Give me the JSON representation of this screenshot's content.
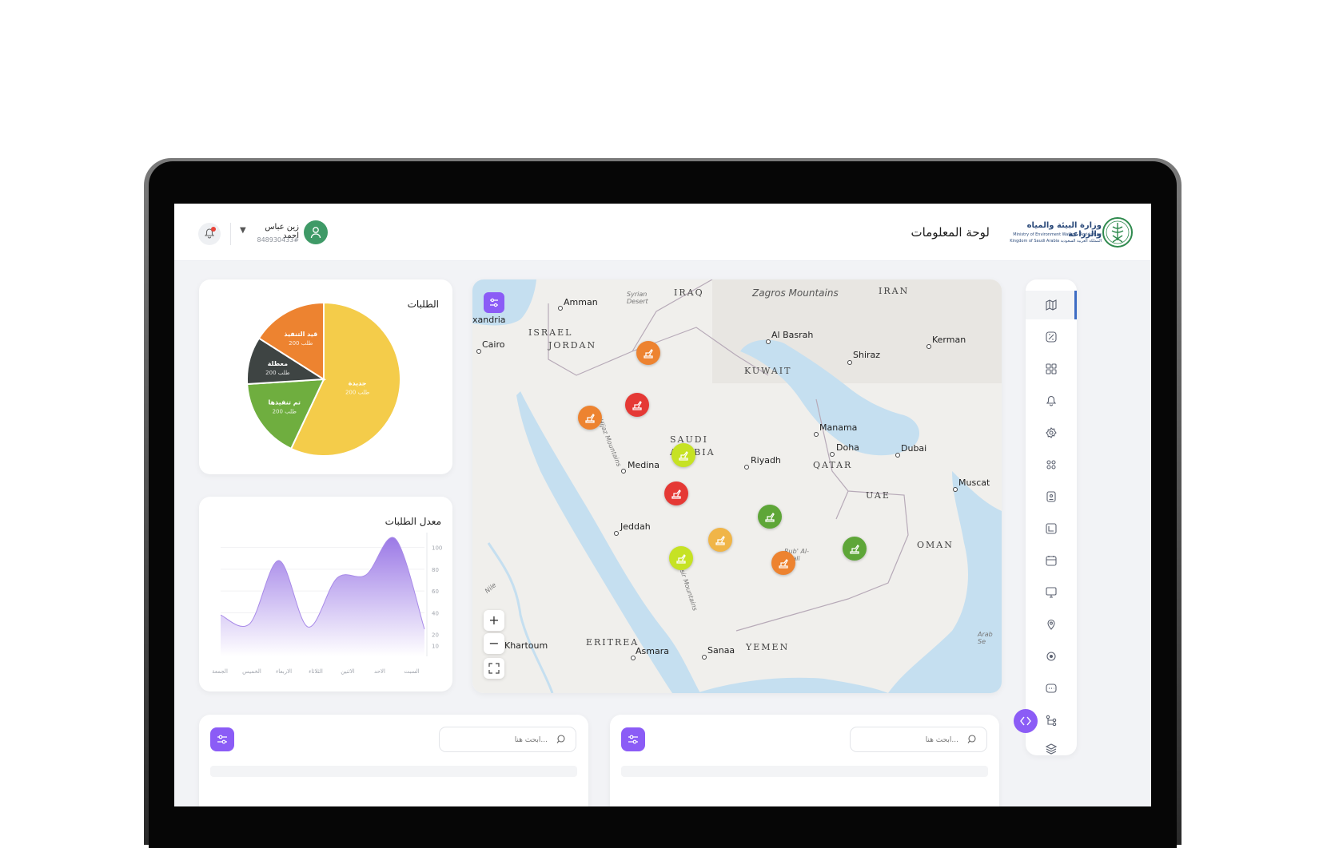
{
  "header": {
    "page_title": "لوحة المعلومات",
    "user_name": "زين عباس احمد",
    "user_id": "848930433#",
    "logo_line1": "وزارة البيئة والمياه والزراعة",
    "logo_line2": "Ministry of Environment Water & Agriculture",
    "logo_line3": "Kingdom of Saudi Arabia  المملكة العربية السعودية"
  },
  "pie_card": {
    "title": "الطلبات",
    "slices": [
      {
        "label": "جديدة",
        "sub": "200 طلب",
        "color": "#f4cc4a"
      },
      {
        "label": "تم تنفيذها",
        "sub": "200 طلب",
        "color": "#6fae3f"
      },
      {
        "label": "معطلة",
        "sub": "200 طلب",
        "color": "#3e4443"
      },
      {
        "label": "قيد التنفيذ",
        "sub": "200 طلب",
        "color": "#ed8330"
      }
    ]
  },
  "line_card": {
    "title": "معدل الطلبات",
    "y_ticks": [
      "100",
      "80",
      "60",
      "40",
      "20",
      "10"
    ],
    "x_ticks": [
      "السبت",
      "الاحد",
      "الاثنين",
      "الثلاثاء",
      "الاربعاء",
      "الخميس",
      "الجمعة"
    ]
  },
  "chart_data": [
    {
      "type": "pie",
      "title": "الطلبات",
      "categories": [
        "جديدة",
        "تم تنفيذها",
        "معطلة",
        "قيد التنفيذ"
      ],
      "values": [
        0.57,
        0.17,
        0.1,
        0.16
      ]
    },
    {
      "type": "area",
      "title": "معدل الطلبات",
      "x": [
        "الجمعة",
        "الخميس",
        "الاربعاء",
        "الثلاثاء",
        "الاثنين",
        "الاحد",
        "السبت"
      ],
      "values": [
        38,
        30,
        88,
        27,
        72,
        75,
        108,
        25
      ],
      "ylim": [
        0,
        110
      ],
      "y_ticks": [
        10,
        20,
        40,
        60,
        80,
        100
      ]
    }
  ],
  "map": {
    "labels": {
      "iraq": "IRAQ",
      "iran": "IRAN",
      "zagros": "Zagros Mountains",
      "israel": "ISRAEL",
      "jordan": "JORDAN",
      "kuwait": "KUWAIT",
      "saudi1": "SAUDI",
      "saudi2": "ARABIA",
      "qatar": "QATAR",
      "uae": "UAE",
      "oman": "OMAN",
      "yemen": "YEMEN",
      "eritrea": "ERITREA",
      "amman": "Amman",
      "cairo": "Cairo",
      "alexandria": "xandria",
      "albasrah": "Al Basrah",
      "kerman": "Kerman",
      "shiraz": "Shiraz",
      "manama": "Manama",
      "doha": "Doha",
      "dubai": "Dubai",
      "muscat": "Muscat",
      "riyadh": "Riyadh",
      "medina": "Medina",
      "jeddah": "Jeddah",
      "khartoum": "Khartoum",
      "asmara": "Asmara",
      "sanaa": "Sanaa",
      "syrian": "Syrian Desert",
      "hijaz": "Hijaz Mountains",
      "asir": "Asir Mountains",
      "rub": "Rub' Al-Khali",
      "nile": "Nile",
      "arab": "Arab Se"
    },
    "zoom_in": "+",
    "zoom_out": "−",
    "markers": [
      {
        "color": "#ed8330"
      },
      {
        "color": "#e53935"
      },
      {
        "color": "#ed8330"
      },
      {
        "color": "#c6e224"
      },
      {
        "color": "#e53935"
      },
      {
        "color": "#5ea638"
      },
      {
        "color": "#f0b548"
      },
      {
        "color": "#c6e224"
      },
      {
        "color": "#ed8330"
      },
      {
        "color": "#5ea638"
      }
    ]
  },
  "bottom": {
    "search_placeholder_left": "ابحث هنا...",
    "search_placeholder_right": "ابحث هنا..."
  },
  "sidebar": {
    "items": [
      "map-icon",
      "analytics-icon",
      "grid-icon",
      "bell-icon",
      "settings-icon",
      "nodes-icon",
      "id-card-icon",
      "finance-icon",
      "calendar-icon",
      "monitor-icon",
      "pin-icon",
      "gear-cert-icon",
      "chat-icon",
      "tree-icon",
      "layers-icon"
    ]
  }
}
